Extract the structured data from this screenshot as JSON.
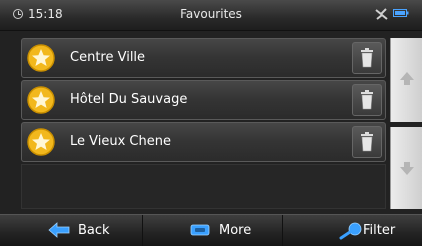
{
  "status_bar": {
    "time": "15:18",
    "title": "Favourites",
    "icons": [
      "clock-icon",
      "gps-icon",
      "battery-icon"
    ]
  },
  "favourites": {
    "items": [
      {
        "label": "Centre Ville",
        "icon": "star-icon",
        "action_icon": "bin-icon"
      },
      {
        "label": "Hôtel Du Sauvage",
        "icon": "star-icon",
        "action_icon": "bin-icon"
      },
      {
        "label": "Le Vieux Chene",
        "icon": "star-icon",
        "action_icon": "bin-icon"
      }
    ]
  },
  "scroll": {
    "up_icon": "arrow-up-icon",
    "down_icon": "arrow-down-icon"
  },
  "toolbar": {
    "back_label": "Back",
    "more_label": "More",
    "filter_label": "Filter"
  },
  "colors": {
    "accent_blue": "#2f8fe0",
    "star_yellow": "#f2b81d",
    "item_bg": "#3a3a3a"
  }
}
